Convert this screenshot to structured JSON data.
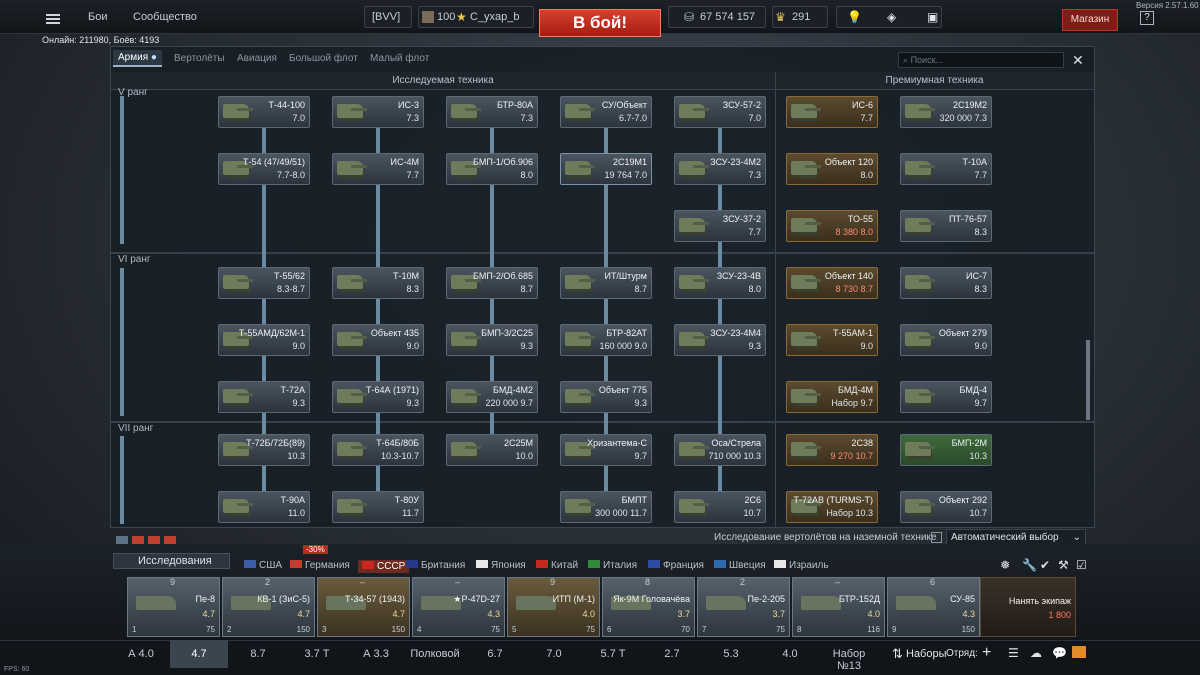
{
  "version": "Версия 2.57.1.60",
  "topbar": {
    "battles": "Бои",
    "community": "Сообщество",
    "clan": "[BVV]",
    "lvl": "100",
    "user": "C_yxap_b",
    "battle": "В бой!",
    "silver": "67 574 157",
    "gold": "291",
    "shop": "Магазин",
    "help": "?"
  },
  "online": "Онлайн: 211980, Боёв: 4193",
  "tabs": [
    "Армия",
    "Вертолёты",
    "Авиация",
    "Большой флот",
    "Малый флот"
  ],
  "search_ph": "Поиск...",
  "hdr": {
    "research": "Исследуемая техника",
    "premium": "Премиумная техника"
  },
  "ranks": [
    "V ранг",
    "VI ранг",
    "VII ранг"
  ],
  "col1": [
    {
      "n": "Т-44-100",
      "b": "7.0"
    },
    {
      "n": "Т-54 (47/49/51)",
      "b": "7.7-8.0"
    },
    {
      "n": "Т-55/62",
      "b": "8.3-8.7"
    },
    {
      "n": "Т-55АМД/62М-1",
      "b": "9.0"
    },
    {
      "n": "Т-72А",
      "b": "9.3"
    },
    {
      "n": "Т-72Б/72Б(89)",
      "b": "10.3"
    },
    {
      "n": "Т-90А",
      "b": "11.0"
    }
  ],
  "col2": [
    {
      "n": "ИС-3",
      "b": "7.3"
    },
    {
      "n": "ИС-4М",
      "b": "7.7"
    },
    {
      "n": "Т-10М",
      "b": "8.3"
    },
    {
      "n": "Объект 435",
      "b": "9.0"
    },
    {
      "n": "Т-64А (1971)",
      "b": "9.3"
    },
    {
      "n": "Т-64Б/80Б",
      "b": "10.3-10.7"
    },
    {
      "n": "Т-80У",
      "b": "11.7"
    }
  ],
  "col3": [
    {
      "n": "БТР-80А",
      "b": "7.3"
    },
    {
      "n": "БМП-1/Об.906",
      "b": "8.0"
    },
    {
      "n": "БМП-2/Об.685",
      "b": "8.7"
    },
    {
      "n": "БМП-3/2С25",
      "b": "9.3"
    },
    {
      "n": "БМД-4М2",
      "b": "220 000 9.7"
    },
    {
      "n": "2С25М",
      "b": "10.0"
    }
  ],
  "col4": [
    {
      "n": "СУ/Объект",
      "b": "6.7-7.0"
    },
    {
      "n": "2С19М1",
      "b": "19 764 7.0"
    },
    {
      "n": "ИТ/Штурм",
      "b": "8.7"
    },
    {
      "n": "БТР-82АТ",
      "b": "160 000 9.0"
    },
    {
      "n": "Объект 775",
      "b": "9.3"
    },
    {
      "n": "Хризантема-С",
      "b": "9.7"
    },
    {
      "n": "БМПТ",
      "b": "300 000 11.7"
    }
  ],
  "col5": [
    {
      "n": "ЗСУ-57-2",
      "b": "7.0"
    },
    {
      "n": "ЗСУ-23-4М2",
      "b": "7.3"
    },
    {
      "n": "ЗСУ-37-2",
      "b": "7.7"
    },
    {
      "n": "ЗСУ-23-4В",
      "b": "8.0"
    },
    {
      "n": "ЗСУ-23-4М4",
      "b": "9.3"
    },
    {
      "n": "Оса/Стрела",
      "b": "710 000 10.3"
    },
    {
      "n": "2С6",
      "b": "10.7"
    }
  ],
  "prem1": [
    {
      "n": "ИС-6",
      "b": "7.7"
    },
    {
      "n": "Объект 120",
      "b": "8.0"
    },
    {
      "n": "ТО-55",
      "b": "8 380 8.0"
    },
    {
      "n": "Объект 140",
      "b": "8 730 8.7"
    },
    {
      "n": "Т-55АМ-1",
      "b": "9.0"
    },
    {
      "n": "БМД-4М",
      "b": "Набор 9.7"
    },
    {
      "n": "2С38",
      "b": "9 270 10.7"
    },
    {
      "n": "Т-72АВ (TURMS-T)",
      "b": "Набор 10.3"
    }
  ],
  "prem2": [
    {
      "n": "2С19М2",
      "b": "320 000 7.3"
    },
    {
      "n": "Т-10А",
      "b": "7.7"
    },
    {
      "n": "ПТ-76-57",
      "b": "8.3"
    },
    {
      "n": "ИС-7",
      "b": "8.3"
    },
    {
      "n": "Объект 279",
      "b": "9.0"
    },
    {
      "n": "БМД-4",
      "b": "9.7"
    },
    {
      "n": "БМП-2М",
      "b": "10.3"
    },
    {
      "n": "Объект 292",
      "b": "10.7"
    }
  ],
  "heli_research": "Исследование вертолётов на наземной технике",
  "auto_select": "Автоматический выбор",
  "research_btn": "Исследования",
  "nations": [
    "США",
    "Германия",
    "СССР",
    "Британия",
    "Япония",
    "Китай",
    "Италия",
    "Франция",
    "Швеция",
    "Израиль"
  ],
  "discount": "-30%",
  "crew": [
    {
      "num": "9",
      "n": "Пе-8",
      "b": "4.7",
      "slot": "1",
      "cost": "75"
    },
    {
      "num": "2",
      "n": "КВ-1 (ЗиС-5)",
      "b": "4.7",
      "slot": "2",
      "cost": "150"
    },
    {
      "num": "–",
      "n": "Т-34-57 (1943)",
      "b": "4.7",
      "slot": "3",
      "cost": "150"
    },
    {
      "num": "–",
      "n": "★Р-47D-27",
      "b": "4.3",
      "slot": "4",
      "cost": "75"
    },
    {
      "num": "9",
      "n": "ИТП (М-1)",
      "b": "4.0",
      "slot": "5",
      "cost": "75"
    },
    {
      "num": "8",
      "n": "Як-9М Головачёва",
      "b": "3.7",
      "slot": "6",
      "cost": "70"
    },
    {
      "num": "2",
      "n": "Пе-2-205",
      "b": "3.7",
      "slot": "7",
      "cost": "75"
    },
    {
      "num": "–",
      "n": "БТР-152Д",
      "b": "4.0",
      "slot": "8",
      "cost": "116"
    },
    {
      "num": "6",
      "n": "СУ-85",
      "b": "4.3",
      "slot": "9",
      "cost": "150"
    }
  ],
  "hire": {
    "t": "Нанять экипаж",
    "c": "1 800"
  },
  "presets": [
    "А 4.0",
    "4.7",
    "8.7",
    "3.7 Т",
    "А 3.3",
    "Полковой",
    "6.7",
    "7.0",
    "5.7 Т",
    "2.7",
    "5.3",
    "4.0",
    "Набор №13"
  ],
  "presets_label": "Наборы",
  "squad": "Отряд:",
  "fps": "FPS: 60",
  "colors": {
    "battle": "#c8321f",
    "accent": "#8b6a36"
  }
}
